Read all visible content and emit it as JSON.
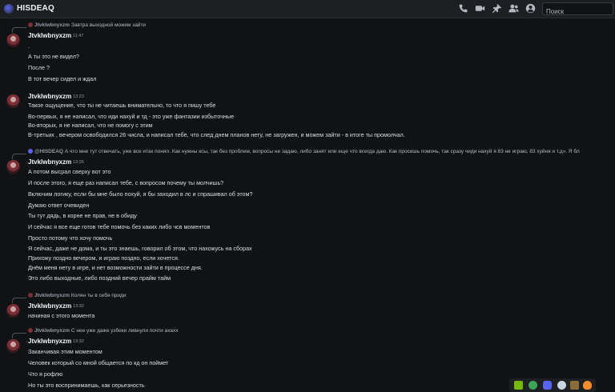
{
  "channel": {
    "name": "HISDEAQ"
  },
  "toolbar": {
    "icons": [
      "phone-icon",
      "video-icon",
      "pin-icon",
      "members-icon",
      "user-profile-icon"
    ]
  },
  "search": {
    "placeholder": "Поиск"
  },
  "messages": [
    {
      "reply": {
        "author": "Jtvklwbnyxzm",
        "text": "Завтра выходной можем зайти"
      },
      "author": "Jtvklwbnyxzm",
      "time": "11:47",
      "lines": [
        ".",
        "А ты это не видел?",
        "После ?",
        "В тот вечер сидел и ждал"
      ]
    },
    {
      "author": "Jtvklwbnyxzm",
      "time": "13:23",
      "lines": [
        "Такое ощущение, что ты не читаешь внимательно, то что я пишу тебе",
        "Во-первых, я не написал, что иди нахуй и тд - это уже фантазии избыточные",
        "Во-вторых, я не написал, что не помогу с этим",
        "В-третьих , вечером освободился 26 числа, и написал тебе, что след днем планов нету, не загружен, и можем зайти - в итоге ты промолчал."
      ]
    },
    {
      "reply": {
        "author": "@HISDEAQ",
        "text": "А что мне тут отвечать, уже все итак понял. Как нужны ксы, так без проблем, вопросы не задаю, либо занят или еще что всегда даю. Как просишь помочь, так сразу чиди нахуй я 83 не играю, 83 хуйня и т.д». Я бл"
      },
      "author": "Jtvklwbnyxzm",
      "time": "13:26",
      "lines": [
        "А потом высрал сверху вот это",
        "И после этого, я еще раз написал тебе, с вопросом почему ты молчишь?",
        "Включим логику, если бы мне было похуй, я бы  заходил в лс и спрашивал об этом?",
        "Думаю ответ очевиден",
        "Ты тут дядь, в корне не прав, не в обиду",
        "И сейчас я все еще готов тебе помочь без каких либо чсв моментов",
        "Просто потому что хочу помочь",
        "Я сейчас, даже не дома, и ты это знаешь, говорил об этом, что нахожусь на сборах",
        "Прихожу поздно вечером, и играю поздно, если хочется.",
        "Днём меня нету в игре, и нет возможности зайти в процессе дня.",
        "Это либо выходные, либо поздний вечер прайм тайм"
      ]
    },
    {
      "reply": {
        "author": "Jtvklwbnyxzm",
        "text": "Колян ты в себя приди"
      },
      "author": "Jtvklwbnyxzm",
      "time": "13:32",
      "lines": [
        "начиная с этого момента"
      ]
    },
    {
      "reply": {
        "author": "Jtvklwbnyxzm",
        "text": "С нее уже даже узбеки ливнули почти ахахх"
      },
      "author": "Jtvklwbnyxzm",
      "time": "13:32",
      "lines": [
        "Заканчивая этим моментом",
        "Человек который со мной общается по кд он поймет",
        "Что я рофлю",
        "Но ты это воспринимаешь, как серьезность"
      ]
    }
  ],
  "dock": {
    "icons": [
      "nvidia-icon",
      "green-circle-icon",
      "discord-icon",
      "steam-icon",
      "game-icon",
      "fire-icon"
    ],
    "colors": [
      "#76b900",
      "#3ba55c",
      "#5865f2",
      "#c7d5e0",
      "#8a6d3b",
      "#f08c2b"
    ]
  }
}
